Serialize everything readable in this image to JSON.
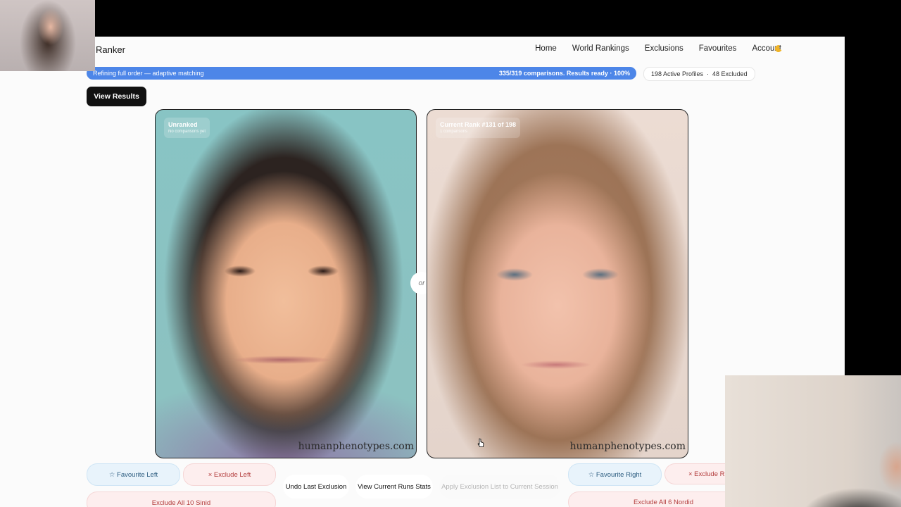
{
  "header": {
    "brand": "Ranker",
    "nav": [
      "Home",
      "World Rankings",
      "Exclusions",
      "Favourites",
      "Account"
    ],
    "theme_icon": "moon-icon"
  },
  "progress": {
    "left_text": "Refining full order — adaptive matching",
    "right_text": "335/319 comparisons. Results ready",
    "percent": "100%",
    "value": 1.0
  },
  "profiles": {
    "active": "198 Active Profiles",
    "excluded": "48 Excluded"
  },
  "view_results_label": "View Results",
  "left_card": {
    "title": "Unranked",
    "subtitle": "No comparisons yet",
    "watermark": "humanphenotypes.com"
  },
  "right_card": {
    "title": "Current Rank #131 of 198",
    "subtitle": "1 comparisons",
    "watermark": "humanphenotypes.com"
  },
  "or_label": "or",
  "actions": {
    "favourite_left": "☆ Favourite Left",
    "exclude_left": "× Exclude Left",
    "undo": "Undo Last Exclusion",
    "view_stats": "View Current Runs Stats",
    "apply_exclusion": "Apply Exclusion List to Current Session",
    "favourite_right": "☆ Favourite Right",
    "exclude_right": "× Exclude Ri",
    "exclude_all_left": "Exclude All 10 Sinid",
    "exclude_all_right": "Exclude All 6 Nordid"
  },
  "colors": {
    "progress": "#4d86e8",
    "primary_button": "#111111",
    "favourite": "#e8f3fb",
    "exclude": "#fdeeee"
  }
}
